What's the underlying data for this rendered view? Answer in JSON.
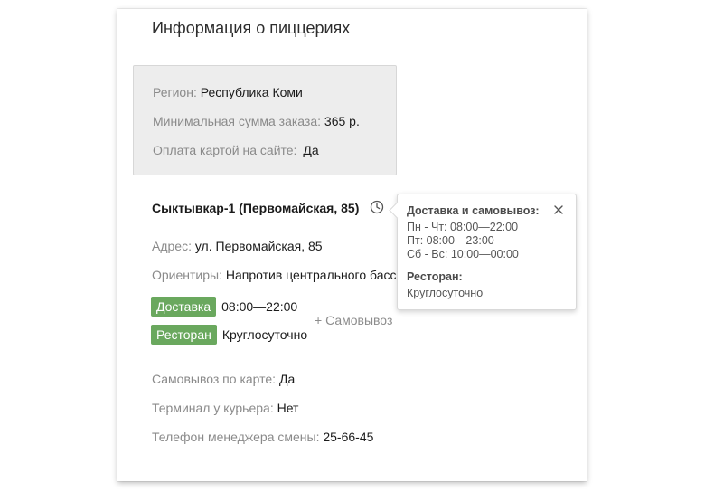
{
  "header": {
    "title": "Информация о пиццериях"
  },
  "region_info": {
    "region_label": "Регион:",
    "region_value": "Республика Коми",
    "min_order_label": "Минимальная сумма заказа:",
    "min_order_value": "365 р.",
    "card_payment_label": "Оплата картой на сайте:",
    "card_payment_value": "Да"
  },
  "pizzeria": {
    "name": "Сыктывкар-1 (Первомайская, 85)",
    "address_label": "Адрес:",
    "address_value": "ул. Первомайская, 85",
    "landmarks_label": "Ориентиры:",
    "landmarks_value": "Напротив центрального басс",
    "delivery_badge": "Доставка",
    "delivery_hours": "08:00—22:00",
    "restaurant_badge": "Ресторан",
    "restaurant_hours": "Круглосуточно",
    "pickup_link": "+ Самовывоз",
    "pickup_card_label": "Самовывоз по карте:",
    "pickup_card_value": "Да",
    "terminal_label": "Терминал у курьера:",
    "terminal_value": "Нет",
    "manager_phone_label": "Телефон менеджера смены:",
    "manager_phone_value": "25-66-45"
  },
  "popover": {
    "delivery_title": "Доставка и самовывоз:",
    "schedule": [
      "Пн - Чт: 08:00—22:00",
      "Пт: 08:00—23:00",
      "Сб - Вс: 10:00—00:00"
    ],
    "restaurant_title": "Ресторан:",
    "restaurant_hours": "Круглосуточно"
  },
  "icons": {
    "clock": "clock-icon",
    "close": "close-icon"
  },
  "colors": {
    "badge_green": "#6aa85e",
    "label_gray": "#8a8a8a"
  }
}
